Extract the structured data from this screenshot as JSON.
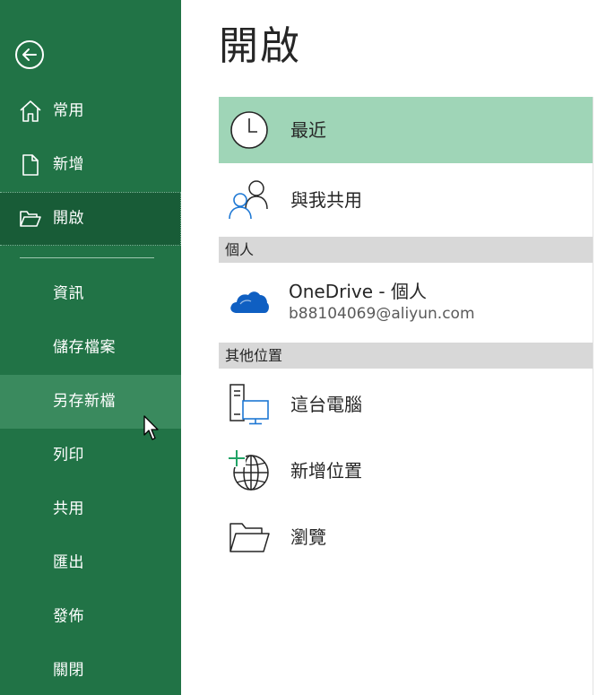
{
  "sidebar": {
    "items": [
      {
        "label": "常用"
      },
      {
        "label": "新增"
      },
      {
        "label": "開啟"
      },
      {
        "label": "資訊"
      },
      {
        "label": "儲存檔案"
      },
      {
        "label": "另存新檔"
      },
      {
        "label": "列印"
      },
      {
        "label": "共用"
      },
      {
        "label": "匯出"
      },
      {
        "label": "發佈"
      },
      {
        "label": "關閉"
      }
    ]
  },
  "main": {
    "title": "開啟",
    "locations": {
      "recent": "最近",
      "shared": "與我共用"
    },
    "sections": {
      "personal": "個人",
      "other": "其他位置"
    },
    "onedrive": {
      "title": "OneDrive - 個人",
      "account": "b88104069@aliyun.com"
    },
    "other_locations": {
      "this_pc": "這台電腦",
      "add_place": "新增位置",
      "browse": "瀏覽"
    }
  },
  "colors": {
    "sidebar": "#217346",
    "sidebar_active": "#185c37",
    "sidebar_hover": "#3a8a5e",
    "selected": "#9fd5b7",
    "onedrive": "#0f5fc2",
    "pc_blue": "#1e78d4",
    "plus_green": "#21a366"
  },
  "icons": {
    "back": "back-arrow-icon",
    "home": "home-icon",
    "new": "new-document-icon",
    "open": "open-folder-icon",
    "recent": "clock-icon",
    "shared": "people-icon",
    "onedrive": "cloud-icon",
    "pc": "computer-icon",
    "add_place": "globe-plus-icon",
    "browse": "folder-icon"
  }
}
